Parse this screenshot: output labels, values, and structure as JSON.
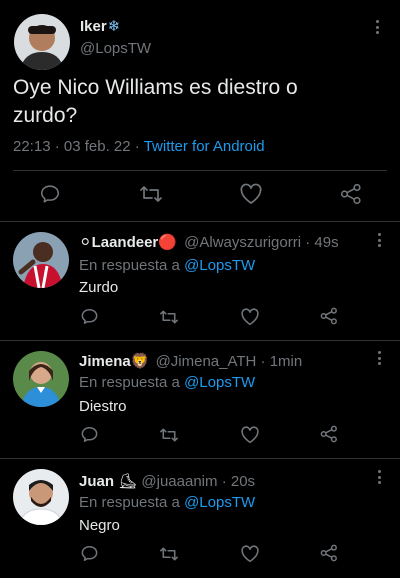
{
  "main_tweet": {
    "name": "Iker",
    "name_emoji": "❄",
    "handle": "@LopsTW",
    "text_line1": "Oye Nico Williams es diestro o",
    "text_line2": "zurdo?",
    "time": "22:13",
    "date": "· 03 feb. 22 ·",
    "source": "Twitter for Android"
  },
  "replies": [
    {
      "name": "Laandeer",
      "lead_emoji": "⚪",
      "trail_emoji": "🔴",
      "handle": "@Alwayszurigorri",
      "time": "· 49s",
      "replying_prefix": "En respuesta a",
      "replying_to": "@LopsTW",
      "text": "Zurdo"
    },
    {
      "name": "Jimena",
      "trail_emoji": "🦁",
      "handle": "@Jimena_ATH",
      "time": "· 1min",
      "replying_prefix": "En respuesta a",
      "replying_to": "@LopsTW",
      "text": "Diestro"
    },
    {
      "name": "Juan",
      "trail_emoji": "⛸",
      "handle": "@juaaanim",
      "time": "· 20s",
      "replying_prefix": "En respuesta a",
      "replying_to": "@LopsTW",
      "text": "Negro"
    }
  ],
  "colors": {
    "background": "#000000",
    "text": "#e7e9ea",
    "muted": "#71767b",
    "link": "#1d9bf0",
    "divider": "#2f3336"
  }
}
